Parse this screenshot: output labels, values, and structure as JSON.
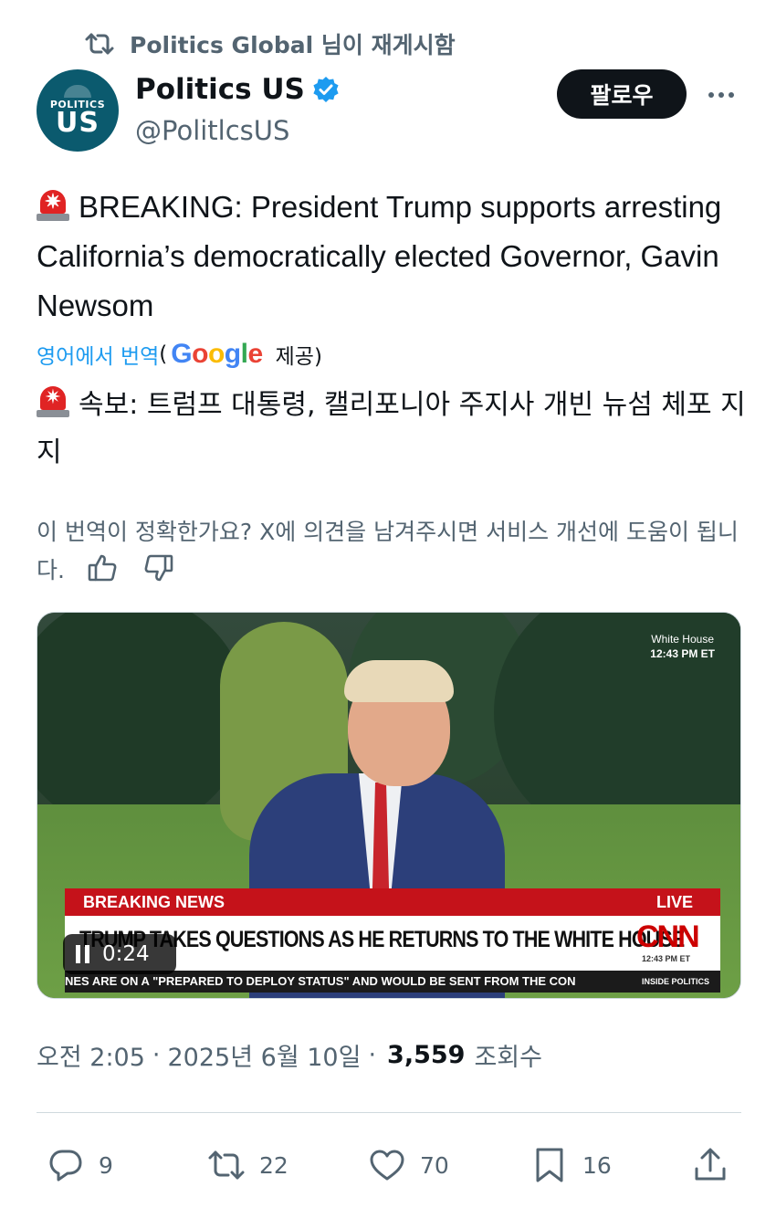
{
  "repost": {
    "text": "Politics Global 님이 재게시함",
    "icon": "repost-icon"
  },
  "author": {
    "avatar": {
      "top_text": "POLITICS",
      "big_text": "US"
    },
    "name": "Politics US",
    "verified_icon": "verified-badge-icon",
    "handle": "@PolitlcsUS"
  },
  "follow_label": "팔로우",
  "more_icon": "more-horizontal-icon",
  "tweet": {
    "siren_icon": "rotating-light-icon",
    "text": "BREAKING: President Trump supports arresting California’s democratically elected Governor, Gavin Newsom"
  },
  "translation": {
    "link_label": "영어에서 번역",
    "open_paren": "(",
    "google": [
      "G",
      "o",
      "o",
      "g",
      "l",
      "e"
    ],
    "provided": "제공)",
    "text": "속보: 트럼프 대통령, 캘리포니아 주지사 개빈 뉴섬 체포 지지"
  },
  "feedback": {
    "text": "이 번역이 정확한가요? X에 의견을 남겨주시면 서비스 개선에 도움이 됩니다.",
    "thumbs_up_icon": "thumbs-up-icon",
    "thumbs_down_icon": "thumbs-down-icon"
  },
  "video": {
    "watermark_label": "White House",
    "watermark_time": "12:43 PM ET",
    "breaking_label": "BREAKING NEWS",
    "live_label": "LIVE",
    "headline": "TRUMP TAKES QUESTIONS AS HE RETURNS TO THE WHITE HOUSE",
    "network": "CNN",
    "network_time": "12:43 PM ET",
    "ticker": "NES ARE ON A \"PREPARED TO DEPLOY STATUS\" AND WOULD BE SENT FROM THE CON",
    "ticker_tag": "INSIDE POLITICS",
    "duration": "0:24",
    "pause_icon": "pause-icon"
  },
  "meta": {
    "time": "오전 2:05",
    "separator": "·",
    "date": "2025년 6월 10일",
    "views_count": "3,559",
    "views_label": "조회수"
  },
  "actions": {
    "reply": {
      "icon": "reply-icon",
      "count": "9"
    },
    "repost": {
      "icon": "repost-icon",
      "count": "22"
    },
    "like": {
      "icon": "heart-icon",
      "count": "70"
    },
    "bookmark": {
      "icon": "bookmark-icon",
      "count": "16"
    },
    "share": {
      "icon": "share-icon"
    }
  },
  "colors": {
    "text_primary": "#0f1419",
    "text_secondary": "#536471",
    "link": "#1d9bf0",
    "verified": "#1d9bf0",
    "button_dark": "#0f1419",
    "cnn_red": "#c5121a"
  }
}
